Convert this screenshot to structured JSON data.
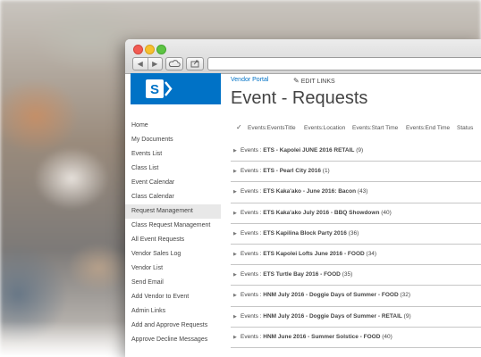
{
  "window": {
    "nav_back": "◀",
    "nav_forward": "▶"
  },
  "site": {
    "breadcrumb": "Vendor Portal",
    "edit_links": "EDIT LINKS",
    "page_title": "Event - Requests"
  },
  "sidebar": {
    "items": [
      {
        "label": "Home"
      },
      {
        "label": "My Documents"
      },
      {
        "label": "Events List"
      },
      {
        "label": "Class List"
      },
      {
        "label": "Event Calendar"
      },
      {
        "label": "Class Calendar"
      },
      {
        "label": "Request Management"
      },
      {
        "label": "Class Request Management"
      },
      {
        "label": "All Event Requests"
      },
      {
        "label": "Vendor Sales Log"
      },
      {
        "label": "Vendor List"
      },
      {
        "label": "Send Email"
      },
      {
        "label": "Add Vendor to Event"
      },
      {
        "label": "Admin Links"
      },
      {
        "label": "Add and Approve Requests"
      },
      {
        "label": "Approve Decline Messages"
      }
    ]
  },
  "list": {
    "columns": [
      "Events:EventsTitle",
      "Events:Location",
      "Events:Start Time",
      "Events:End Time",
      "Status"
    ],
    "group_prefix": "Events : ",
    "groups": [
      {
        "title": "ETS - Kapolei JUNE 2016 RETAIL",
        "count": "(9)"
      },
      {
        "title": "ETS - Pearl City 2016",
        "count": "(1)"
      },
      {
        "title": "ETS Kaka'ako - June 2016: Bacon",
        "count": "(43)"
      },
      {
        "title": "ETS Kaka'ako July 2016 - BBQ Showdown",
        "count": "(40)"
      },
      {
        "title": "ETS Kapilina Block Party 2016",
        "count": "(36)"
      },
      {
        "title": "ETS Kapolei Lofts June 2016 - FOOD",
        "count": "(34)"
      },
      {
        "title": "ETS Turtle Bay 2016 - FOOD",
        "count": "(35)"
      },
      {
        "title": "HNM July 2016 - Doggie Days of Summer - FOOD",
        "count": "(32)"
      },
      {
        "title": "HNM July 2016 - Doggie Days of Summer - RETAIL",
        "count": "(9)"
      },
      {
        "title": "HNM June 2016 - Summer Solstice - FOOD",
        "count": "(40)"
      }
    ]
  },
  "colors": {
    "accent": "#0072c6",
    "text": "#444444"
  },
  "icons": {
    "check": "checkmark-icon",
    "pencil": "pencil-icon",
    "caret": "expand-caret-icon",
    "logo": "sharepoint-logo-icon"
  }
}
